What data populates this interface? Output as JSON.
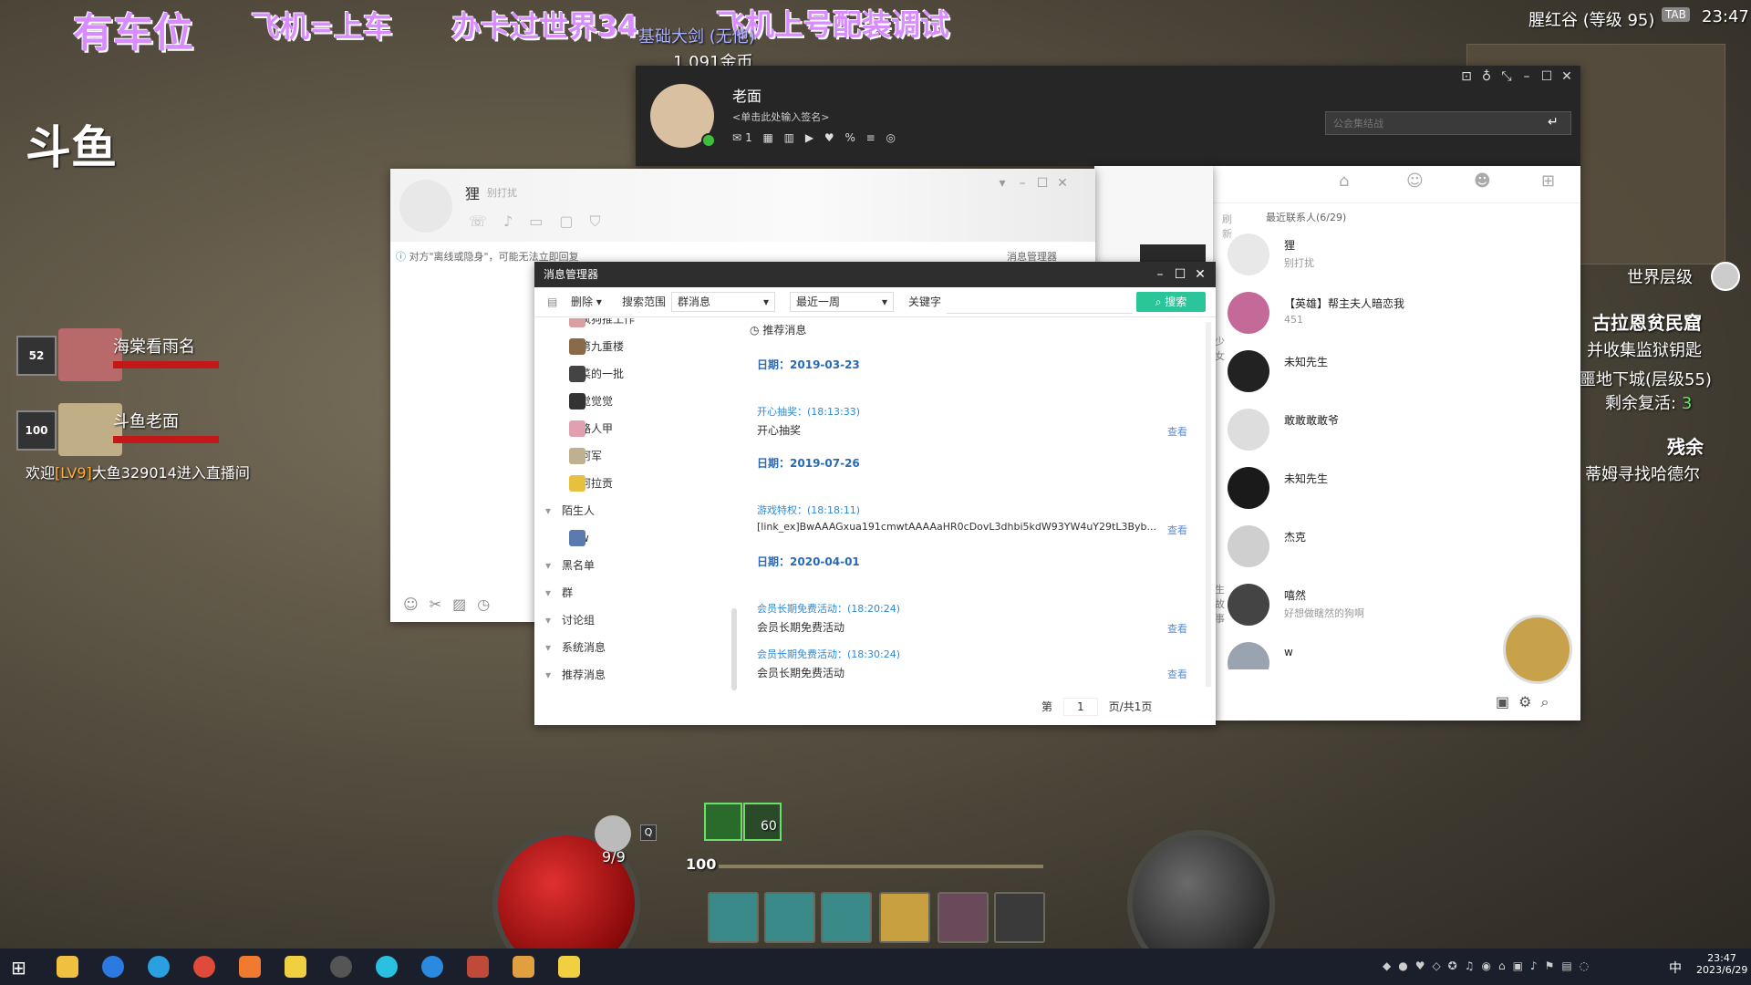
{
  "overlay": {
    "banner_texts": [
      "有车位",
      "飞机=上车",
      "办卡过世界34",
      "飞机上号配装调试"
    ],
    "stream_brand": "斗鱼",
    "subline_1": "基础大剑 (无他)",
    "subline_2": "1,091金币",
    "viewers": [
      {
        "level": "52",
        "name": "海棠看雨名"
      },
      {
        "level": "100",
        "name": "斗鱼老面"
      }
    ],
    "welcome_prefix": "欢迎",
    "welcome_level": "[LV9]",
    "welcome_rest": "大鱼329014进入直播间"
  },
  "game": {
    "zone": "腥红谷 (等级 95)",
    "tab_key": "TAB",
    "clock": "23:47",
    "world_tier": "世界层级",
    "quest_1_title": "古拉恩贫民窟",
    "quest_1_line": "并收集监狱钥匙",
    "quest_2_line": "噩地下城(层级55)",
    "quest_2_revive_label": "剩余复活:",
    "quest_2_revive_value": "3",
    "quest_3_title": "残余",
    "quest_3_line": "蒂姆寻找哈德尔",
    "potion_count": "9/9",
    "potion_key": "Q",
    "level_badge": "100",
    "buff_value": "60"
  },
  "qq_main": {
    "nickname": "老面",
    "signature": "<单击此处输入签名>",
    "status_count": "1",
    "search_placeholder": "公会集结战",
    "recent_label": "最近联系人(6/29)",
    "refresh_label": "刷新",
    "contacts": [
      {
        "name": "狸",
        "sub": "别打扰",
        "color": "#e8e8e8"
      },
      {
        "name": "【英雄】帮主夫人暗恋我",
        "sub": "451",
        "color": "#c46a98"
      },
      {
        "name": "未知先生",
        "sub": "",
        "color": "#222222"
      },
      {
        "name": "敢敢敢敢爷",
        "sub": "",
        "color": "#dddddd"
      },
      {
        "name": "未知先生",
        "sub": "",
        "color": "#1a1a1a"
      },
      {
        "name": "杰克",
        "sub": "",
        "color": "#cfcfcf"
      },
      {
        "name": "嘻然",
        "sub": "好想做瞎然的狗啊",
        "color": "#444444"
      },
      {
        "name": "w",
        "sub": "",
        "color": "#9aa4b0"
      }
    ],
    "thumb_captions": [
      "少女",
      "",
      "生故事"
    ]
  },
  "chat_window": {
    "contact_name": "狸",
    "contact_status": "别打扰",
    "notice": "对方\"离线或隐身\"，可能无法立即回复",
    "msg_manager_link": "消息管理器"
  },
  "msg_manager": {
    "title": "消息管理器",
    "delete_label": "删除",
    "scope_label": "搜索范围",
    "scope_value": "群消息",
    "range_value": "最近一周",
    "keyword_label": "关键字",
    "search_button": "搜索",
    "recommended_label": "推荐消息",
    "tree_items": [
      {
        "name": "疯狗推工作",
        "color": "#d8a0a0"
      },
      {
        "name": "第九重楼",
        "color": "#8a6a4a"
      },
      {
        "name": "菜的一批",
        "color": "#444444"
      },
      {
        "name": "觉觉觉",
        "color": "#333333"
      },
      {
        "name": "路人甲",
        "color": "#e0a0b0"
      },
      {
        "name": "阿军",
        "color": "#c0b090"
      },
      {
        "name": "阿拉贡",
        "color": "#e8c040"
      }
    ],
    "groups": [
      "陌生人",
      "黑名单",
      "群",
      "讨论组",
      "系统消息",
      "推荐消息"
    ],
    "stranger_item": "w",
    "messages": [
      {
        "date_label": "日期：",
        "date": "2019-03-23",
        "head": "开心抽奖：(18:13:33)",
        "body": "开心抽奖",
        "view": "查看"
      },
      {
        "date_label": "日期：",
        "date": "2019-07-26",
        "head": "游戏特权：(18:18:11)",
        "body": "[link_ex]BwAAAGxua191cmwtAAAAaHR0cDovL3dhbi5kdW93YW4uY29tL3Byb...",
        "view": "查看"
      },
      {
        "date_label": "日期：",
        "date": "2020-04-01",
        "head": "会员长期免费活动：(18:20:24)",
        "body": "会员长期免费活动",
        "view": "查看"
      },
      {
        "date_label": "",
        "date": "",
        "head": "会员长期免费活动：(18:30:24)",
        "body": "会员长期免费活动",
        "view": "查看"
      }
    ],
    "page_prefix": "第",
    "page_value": "1",
    "page_suffix": "页/共1页"
  },
  "taskbar": {
    "ime": "中",
    "time": "23:47",
    "date": "2023/6/29"
  }
}
